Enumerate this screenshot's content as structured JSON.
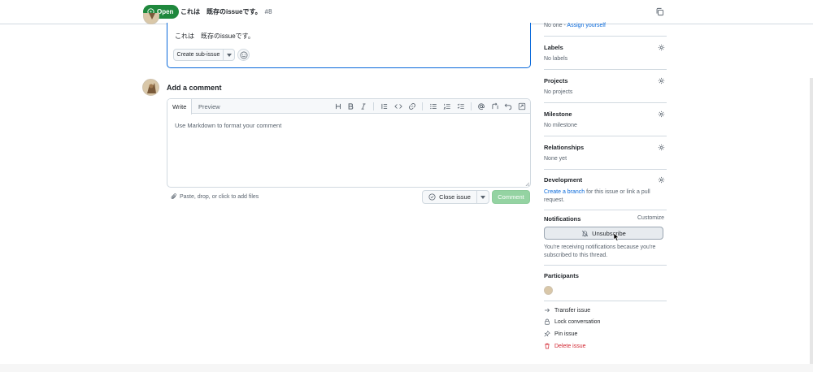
{
  "header": {
    "state_label": "Open",
    "title": "これは　既存のissueです。",
    "number": "#8"
  },
  "issue_body": {
    "text": "これは　既存のissueです。",
    "create_sub_issue_label": "Create sub-issue"
  },
  "comment": {
    "heading": "Add a comment",
    "tab_write": "Write",
    "tab_preview": "Preview",
    "placeholder": "Use Markdown to format your comment",
    "attach_label": "Paste, drop, or click to add files",
    "close_issue_label": "Close issue",
    "comment_label": "Comment",
    "toolbar_icons": [
      "heading-icon",
      "bold-icon",
      "italic-icon",
      "quote-icon",
      "code-icon",
      "link-icon",
      "unordered-list-icon",
      "ordered-list-icon",
      "task-list-icon",
      "mention-icon",
      "reference-icon",
      "undo-icon",
      "fullscreen-icon"
    ]
  },
  "sidebar": {
    "assignees_value": "No one - ",
    "assign_yourself": "Assign yourself",
    "labels": {
      "heading": "Labels",
      "value": "No labels"
    },
    "projects": {
      "heading": "Projects",
      "value": "No projects"
    },
    "milestone": {
      "heading": "Milestone",
      "value": "No milestone"
    },
    "relationships": {
      "heading": "Relationships",
      "value": "None yet"
    },
    "development": {
      "heading": "Development",
      "link": "Create a branch",
      "text_rest": " for this issue or link a pull",
      "text_line2": "request."
    },
    "notifications": {
      "heading": "Notifications",
      "customize": "Customize",
      "unsubscribe": "Unsubscribe",
      "text": "You're receiving notifications because you're subscribed to this thread."
    },
    "participants": {
      "heading": "Participants"
    },
    "actions": [
      {
        "label": "Transfer issue"
      },
      {
        "label": "Lock conversation"
      },
      {
        "label": "Pin issue"
      },
      {
        "label": "Delete issue"
      }
    ]
  },
  "colors": {
    "open_green": "#1f883d",
    "link_blue": "#0969da",
    "danger_red": "#d1242f",
    "comment_disabled": "#94d3a2",
    "border": "#d1d9e0"
  }
}
